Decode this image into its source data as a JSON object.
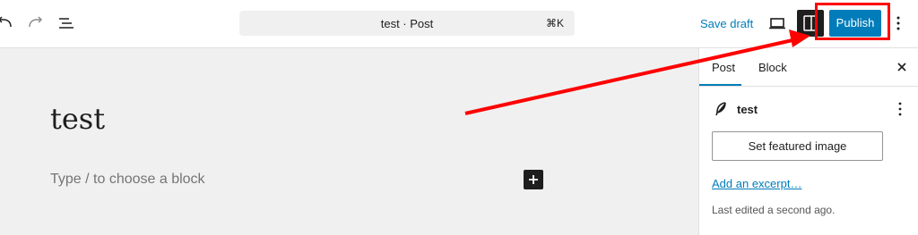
{
  "toolbar": {
    "command_bar_title": "test · Post",
    "command_shortcut": "⌘K",
    "save_draft_label": "Save draft",
    "publish_label": "Publish"
  },
  "icons": {
    "undo": "undo-icon",
    "redo": "redo-icon",
    "document_overview": "list-view-icon",
    "preview": "laptop-icon",
    "settings": "sidebar-toggle-icon",
    "options": "more-vertical-icon",
    "inserter": "plus-icon",
    "close": "close-icon",
    "post_type": "feather-icon"
  },
  "editor": {
    "title": "test",
    "block_placeholder": "Type / to choose a block"
  },
  "sidebar": {
    "tabs": [
      {
        "label": "Post",
        "active": true
      },
      {
        "label": "Block",
        "active": false
      }
    ],
    "post_name": "test",
    "featured_image_label": "Set featured image",
    "excerpt_link": "Add an excerpt…",
    "last_edited": "Last edited a second ago."
  },
  "annotation": {
    "color": "#ff0000",
    "target": "publish-button"
  },
  "colors": {
    "accent": "#007cba",
    "dark": "#1e1e1e",
    "canvas_bg": "#f0f0f0"
  }
}
